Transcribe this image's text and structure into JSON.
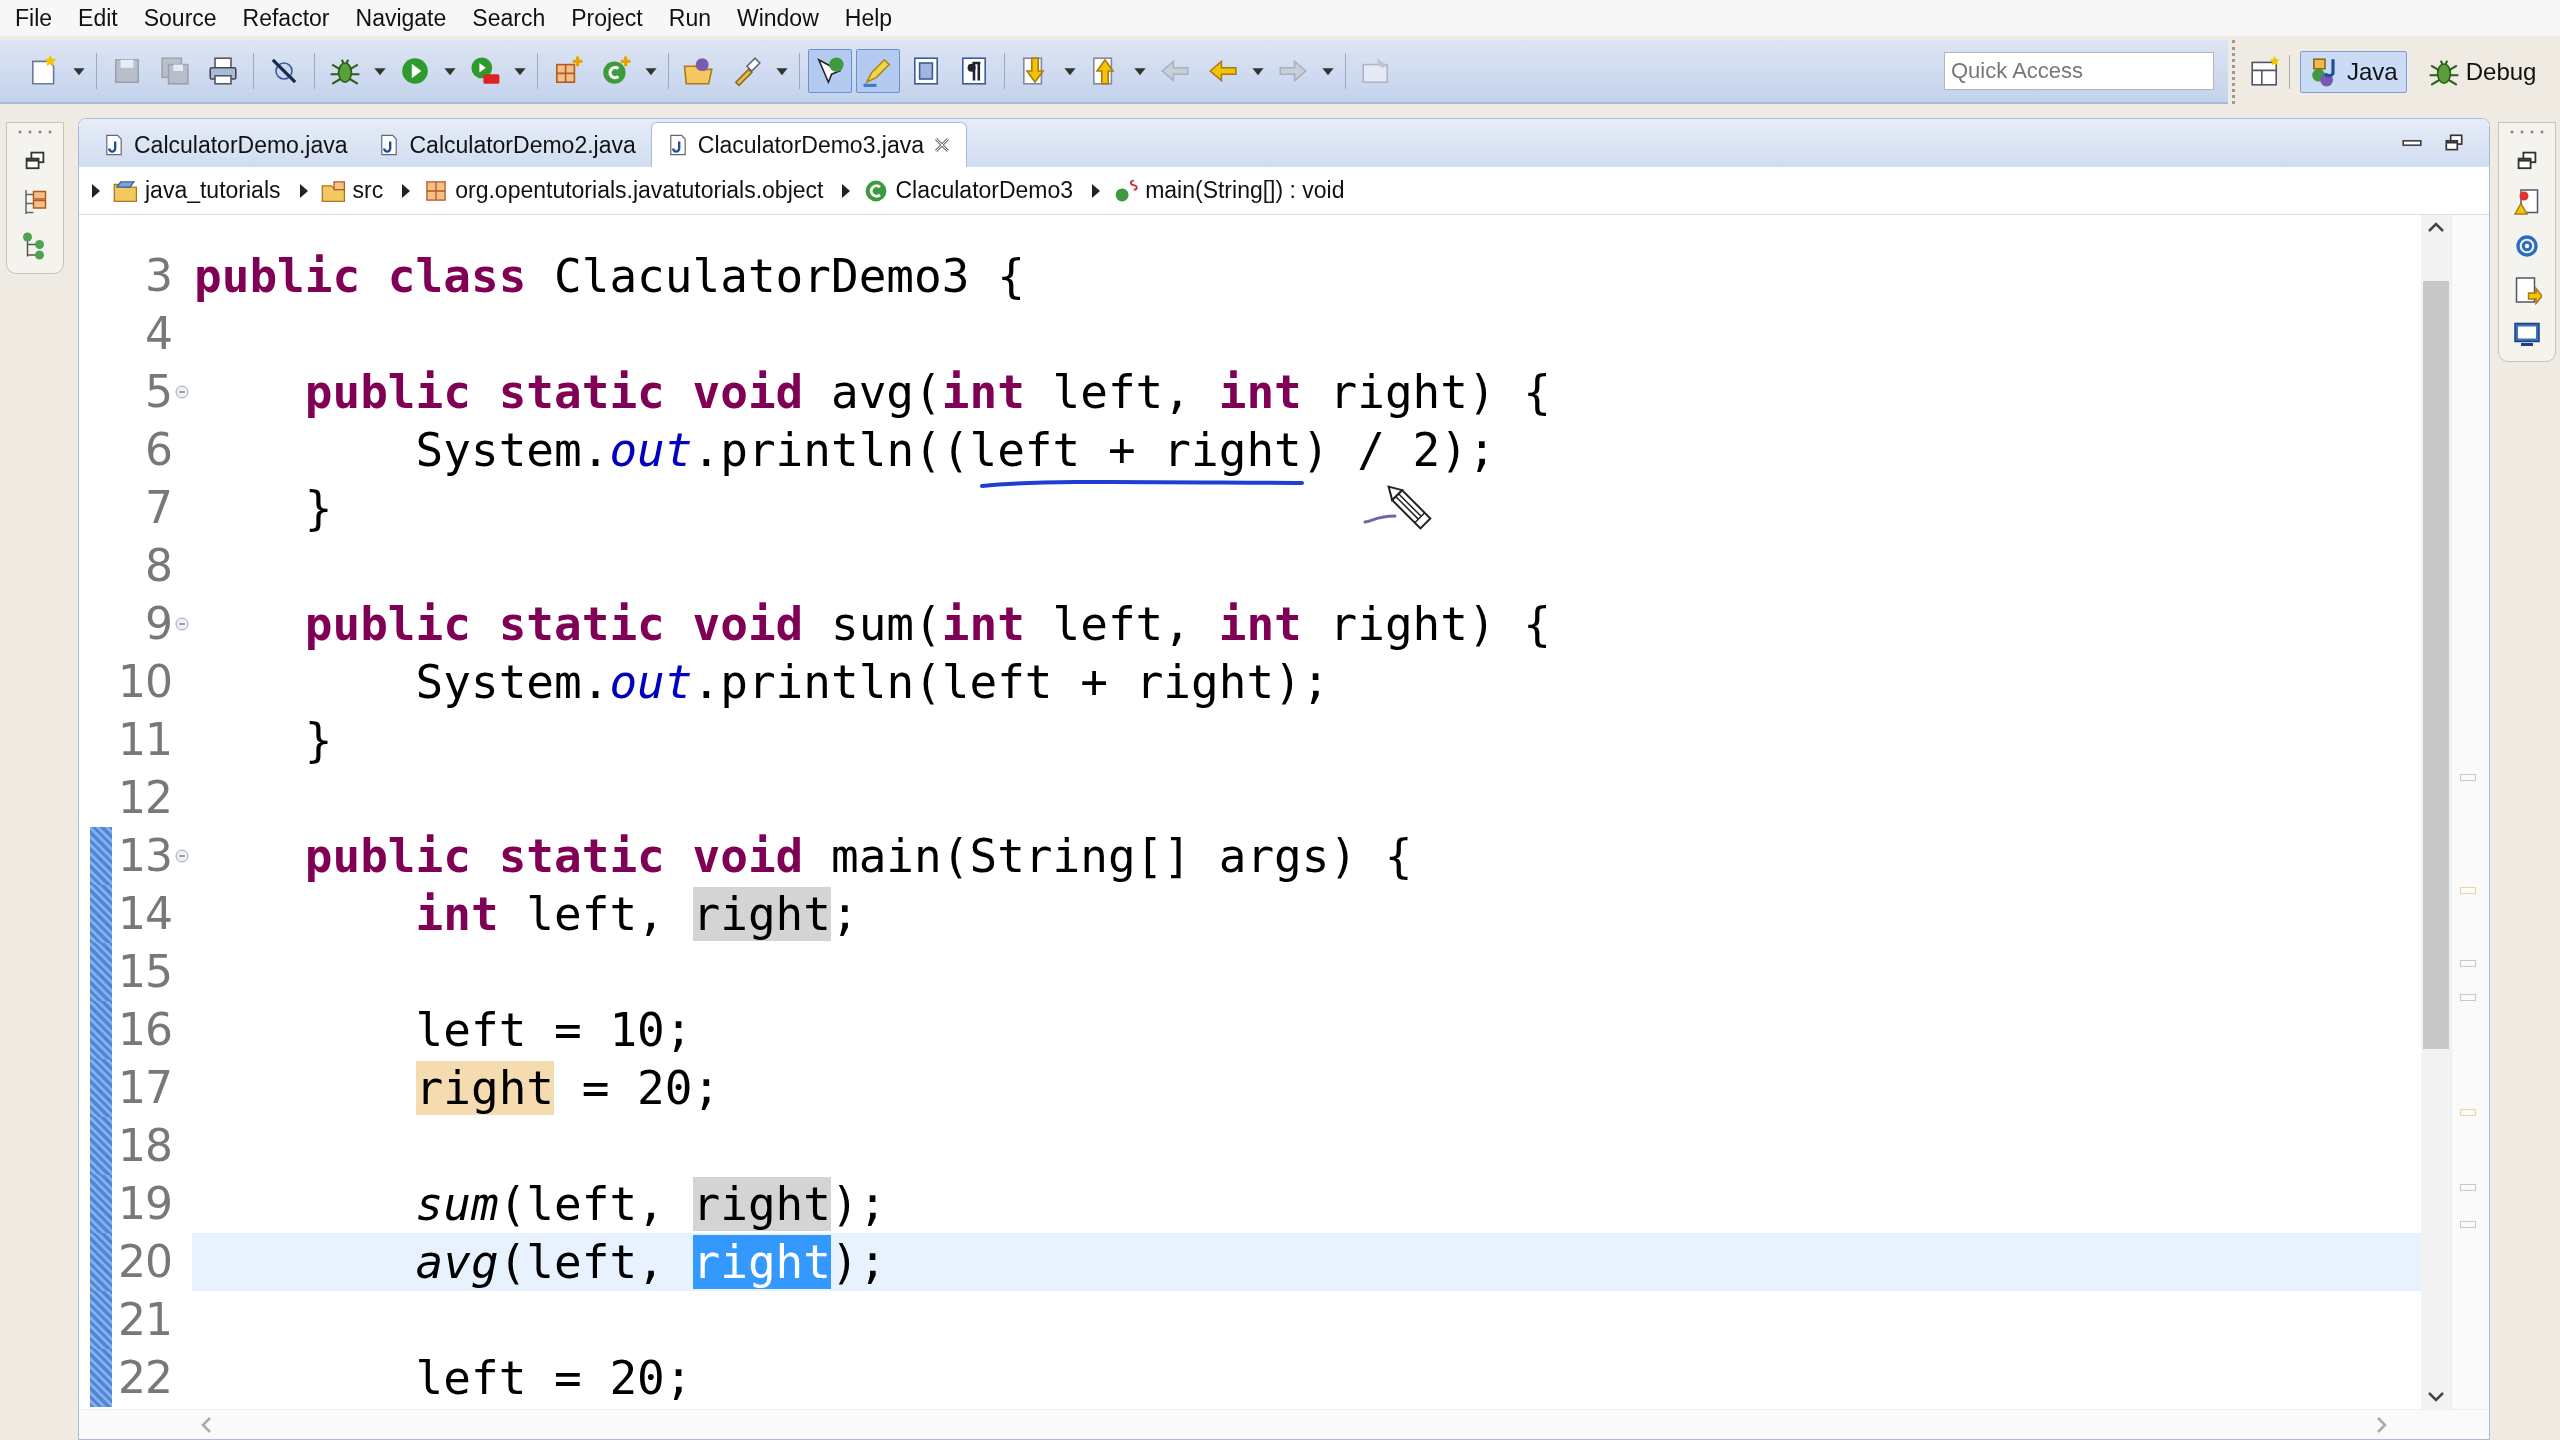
{
  "menu": [
    {
      "label": "File"
    },
    {
      "label": "Edit"
    },
    {
      "label": "Source"
    },
    {
      "label": "Refactor"
    },
    {
      "label": "Navigate"
    },
    {
      "label": "Search"
    },
    {
      "label": "Project"
    },
    {
      "label": "Run"
    },
    {
      "label": "Window"
    },
    {
      "label": "Help"
    }
  ],
  "toolbar": {
    "groups": [
      [
        {
          "kind": "new",
          "dropdown": true,
          "pressed": false,
          "disabled": false
        }
      ],
      [
        {
          "kind": "save",
          "dropdown": false,
          "pressed": false,
          "disabled": true
        },
        {
          "kind": "save_all",
          "dropdown": false,
          "pressed": false,
          "disabled": true
        },
        {
          "kind": "print",
          "dropdown": false,
          "pressed": false,
          "disabled": false
        }
      ],
      [
        {
          "kind": "skip",
          "dropdown": false,
          "pressed": false,
          "disabled": false
        }
      ],
      [
        {
          "kind": "debug",
          "dropdown": true,
          "pressed": false,
          "disabled": false
        },
        {
          "kind": "run",
          "dropdown": true,
          "pressed": false,
          "disabled": false
        },
        {
          "kind": "run_external",
          "dropdown": true,
          "pressed": false,
          "disabled": false
        }
      ],
      [
        {
          "kind": "new_package",
          "dropdown": false,
          "pressed": false,
          "disabled": false
        },
        {
          "kind": "new_class",
          "dropdown": true,
          "pressed": false,
          "disabled": false
        }
      ],
      [
        {
          "kind": "open_type",
          "dropdown": false,
          "pressed": false,
          "disabled": false
        },
        {
          "kind": "search",
          "dropdown": true,
          "pressed": false,
          "disabled": false
        }
      ],
      [
        {
          "kind": "occurrences",
          "dropdown": false,
          "pressed": true,
          "disabled": false
        },
        {
          "kind": "highlight",
          "dropdown": false,
          "pressed": true,
          "disabled": false
        },
        {
          "kind": "block",
          "dropdown": false,
          "pressed": false,
          "disabled": false
        },
        {
          "kind": "whitespace",
          "dropdown": false,
          "pressed": false,
          "disabled": false
        }
      ],
      [
        {
          "kind": "next_annotation",
          "dropdown": true,
          "pressed": false,
          "disabled": false
        },
        {
          "kind": "prev_annotation",
          "dropdown": true,
          "pressed": false,
          "disabled": false
        },
        {
          "kind": "back",
          "dropdown": false,
          "pressed": false,
          "disabled": true
        },
        {
          "kind": "back",
          "dropdown": true,
          "pressed": false,
          "disabled": false
        },
        {
          "kind": "forward",
          "dropdown": true,
          "pressed": false,
          "disabled": true
        }
      ],
      [
        {
          "kind": "pin",
          "dropdown": false,
          "pressed": false,
          "disabled": true
        }
      ]
    ],
    "quick_access": {
      "placeholder": "Quick Access"
    },
    "perspectives": [
      {
        "kind": "java",
        "label": "Java",
        "selected": true
      },
      {
        "kind": "debug",
        "label": "Debug",
        "selected": false
      }
    ]
  },
  "editor_tabs": [
    {
      "label": "CalculatorDemo.java",
      "selected": false
    },
    {
      "label": "CalculatorDemo2.java",
      "selected": false
    },
    {
      "label": "ClaculatorDemo3.java",
      "selected": true
    }
  ],
  "breadcrumb": [
    {
      "kind": "project",
      "label": "java_tutorials"
    },
    {
      "kind": "source_folder",
      "label": "src"
    },
    {
      "kind": "package",
      "label": "org.opentutorials.javatutorials.object"
    },
    {
      "kind": "class",
      "label": "ClaculatorDemo3"
    },
    {
      "kind": "method",
      "label": "main(String[]) : void"
    }
  ],
  "code_lines": [
    {
      "number": "3",
      "current": false,
      "in_scope": false,
      "tokens": [
        {
          "kind": "keyword",
          "text": "public class"
        },
        {
          "kind": "plain",
          "text": " ClaculatorDemo3 {"
        }
      ],
      "children": [
        {
          "number": "4",
          "current": false,
          "in_scope": false
        },
        {
          "number": "5",
          "current": false,
          "in_scope": false,
          "expanded": true,
          "tokens": [
            {
              "kind": "keyword",
              "text": "public static void"
            },
            {
              "kind": "plain",
              "text": " avg("
            },
            {
              "kind": "keyword",
              "text": "int"
            },
            {
              "kind": "plain",
              "text": " left, "
            },
            {
              "kind": "keyword",
              "text": "int"
            },
            {
              "kind": "plain",
              "text": " right) {"
            }
          ],
          "children": [
            {
              "number": "6",
              "current": false,
              "in_scope": false,
              "tokens": [
                {
                  "kind": "plain",
                  "text": "System."
                },
                {
                  "kind": "field",
                  "text": "out"
                },
                {
                  "kind": "plain",
                  "text": ".println((left + right) / 2);"
                }
              ]
            }
          ]
        },
        {
          "number": "7",
          "current": false,
          "in_scope": false,
          "tokens": [
            {
              "kind": "plain",
              "text": "}"
            }
          ]
        },
        {
          "number": "8",
          "current": false,
          "in_scope": false
        },
        {
          "number": "9",
          "current": false,
          "in_scope": false,
          "expanded": true,
          "tokens": [
            {
              "kind": "keyword",
              "text": "public static void"
            },
            {
              "kind": "plain",
              "text": " sum("
            },
            {
              "kind": "keyword",
              "text": "int"
            },
            {
              "kind": "plain",
              "text": " left, "
            },
            {
              "kind": "keyword",
              "text": "int"
            },
            {
              "kind": "plain",
              "text": " right) {"
            }
          ],
          "children": [
            {
              "number": "10",
              "current": false,
              "in_scope": false,
              "tokens": [
                {
                  "kind": "plain",
                  "text": "System."
                },
                {
                  "kind": "field",
                  "text": "out"
                },
                {
                  "kind": "plain",
                  "text": ".println(left + right);"
                }
              ]
            }
          ]
        },
        {
          "number": "11",
          "current": false,
          "in_scope": false,
          "tokens": [
            {
              "kind": "plain",
              "text": "}"
            }
          ]
        },
        {
          "number": "12",
          "current": false,
          "in_scope": false
        },
        {
          "number": "13",
          "current": false,
          "in_scope": true,
          "expanded": true,
          "tokens": [
            {
              "kind": "keyword",
              "text": "public static void"
            },
            {
              "kind": "plain",
              "text": " main(String[] args) {"
            }
          ],
          "children": [
            {
              "number": "14",
              "current": false,
              "in_scope": true,
              "tokens": [
                {
                  "kind": "keyword",
                  "text": "int"
                },
                {
                  "kind": "plain",
                  "text": " left, "
                },
                {
                  "kind": "read",
                  "text": "right"
                },
                {
                  "kind": "plain",
                  "text": ";"
                }
              ]
            },
            {
              "number": "15",
              "current": false,
              "in_scope": true
            },
            {
              "number": "16",
              "current": false,
              "in_scope": true,
              "tokens": [
                {
                  "kind": "plain",
                  "text": "left = 10;"
                }
              ]
            },
            {
              "number": "17",
              "current": false,
              "in_scope": true,
              "tokens": [
                {
                  "kind": "write",
                  "text": "right"
                },
                {
                  "kind": "plain",
                  "text": " = 20;"
                }
              ]
            },
            {
              "number": "18",
              "current": false,
              "in_scope": true
            },
            {
              "number": "19",
              "current": false,
              "in_scope": true,
              "tokens": [
                {
                  "kind": "call",
                  "text": "sum"
                },
                {
                  "kind": "plain",
                  "text": "(left, "
                },
                {
                  "kind": "read",
                  "text": "right"
                },
                {
                  "kind": "plain",
                  "text": ");"
                }
              ]
            },
            {
              "number": "20",
              "current": true,
              "in_scope": true,
              "tokens": [
                {
                  "kind": "call",
                  "text": "avg"
                },
                {
                  "kind": "plain",
                  "text": "(left, "
                },
                {
                  "kind": "selected",
                  "text": "right"
                },
                {
                  "kind": "plain",
                  "text": ");"
                }
              ]
            },
            {
              "number": "21",
              "current": false,
              "in_scope": true
            },
            {
              "number": "22",
              "current": false,
              "in_scope": true,
              "tokens": [
                {
                  "kind": "plain",
                  "text": "left = 20;"
                }
              ]
            }
          ]
        }
      ]
    }
  ]
}
